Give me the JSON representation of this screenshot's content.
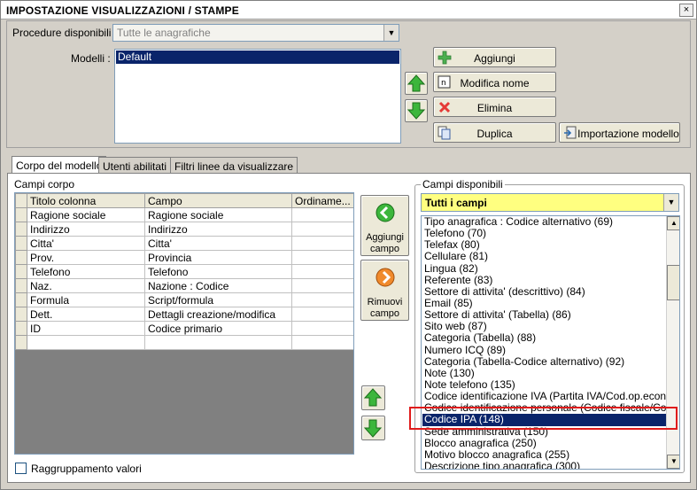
{
  "window": {
    "title": "IMPOSTAZIONE VISUALIZZAZIONI / STAMPE",
    "close_glyph": "×"
  },
  "top": {
    "procedure_label": "Procedure disponibili :",
    "procedure_value": "Tutte le anagrafiche",
    "models_label": "Modelli :",
    "models": [
      "Default"
    ],
    "selected_model": "Default"
  },
  "buttons": {
    "add": "Aggiungi",
    "rename": "Modifica nome",
    "delete": "Elimina",
    "duplicate": "Duplica",
    "import": "Importazione modello",
    "add_field": [
      "Aggiungi",
      "campo"
    ],
    "remove_field": [
      "Rimuovi",
      "campo"
    ]
  },
  "tabs": [
    "Corpo del modello",
    "Utenti abilitati",
    "Filtri linee da visualizzare"
  ],
  "body_fields": {
    "caption": "Campi corpo",
    "columns": [
      "Titolo colonna",
      "Campo",
      "Ordiname..."
    ],
    "rows": [
      [
        "Ragione sociale",
        "Ragione sociale",
        ""
      ],
      [
        "Indirizzo",
        "Indirizzo",
        ""
      ],
      [
        "Citta'",
        "Citta'",
        ""
      ],
      [
        "Prov.",
        "Provincia",
        ""
      ],
      [
        "Telefono",
        "Telefono",
        ""
      ],
      [
        "Naz.",
        "Nazione : Codice",
        ""
      ],
      [
        "Formula",
        "Script/formula",
        ""
      ],
      [
        "Dett.",
        "Dettagli creazione/modifica",
        ""
      ],
      [
        "ID",
        "Codice primario",
        ""
      ],
      [
        "",
        "",
        ""
      ]
    ],
    "group_values_label": "Raggruppamento valori"
  },
  "available": {
    "caption": "Campi disponibili",
    "filter": "Tutti i campi",
    "items": [
      "Tipo anagrafica : Codice alternativo (69)",
      "Telefono (70)",
      "Telefax (80)",
      "Cellulare (81)",
      "Lingua (82)",
      "Referente (83)",
      "Settore di attivita' (descrittivo) (84)",
      "Email (85)",
      "Settore di attivita' (Tabella) (86)",
      "Sito web (87)",
      "Categoria (Tabella) (88)",
      "Numero ICQ (89)",
      "Categoria (Tabella-Codice alternativo) (92)",
      "Note (130)",
      "Note telefono (135)",
      "Codice identificazione IVA (Partita IVA/Cod.op.economico",
      "Codice identificazione personale (Codice fiscale/Codice IS",
      "Codice IPA (148)",
      "Sede amministrativa (150)",
      "Blocco anagrafica (250)",
      "Motivo blocco anagrafica (255)",
      "Descrizione tipo anagrafica (300)"
    ],
    "selected_index": 17
  },
  "colors": {
    "highlight": "#e01b1b",
    "selection": "#0a246a",
    "filter_bg": "#ffff80"
  }
}
